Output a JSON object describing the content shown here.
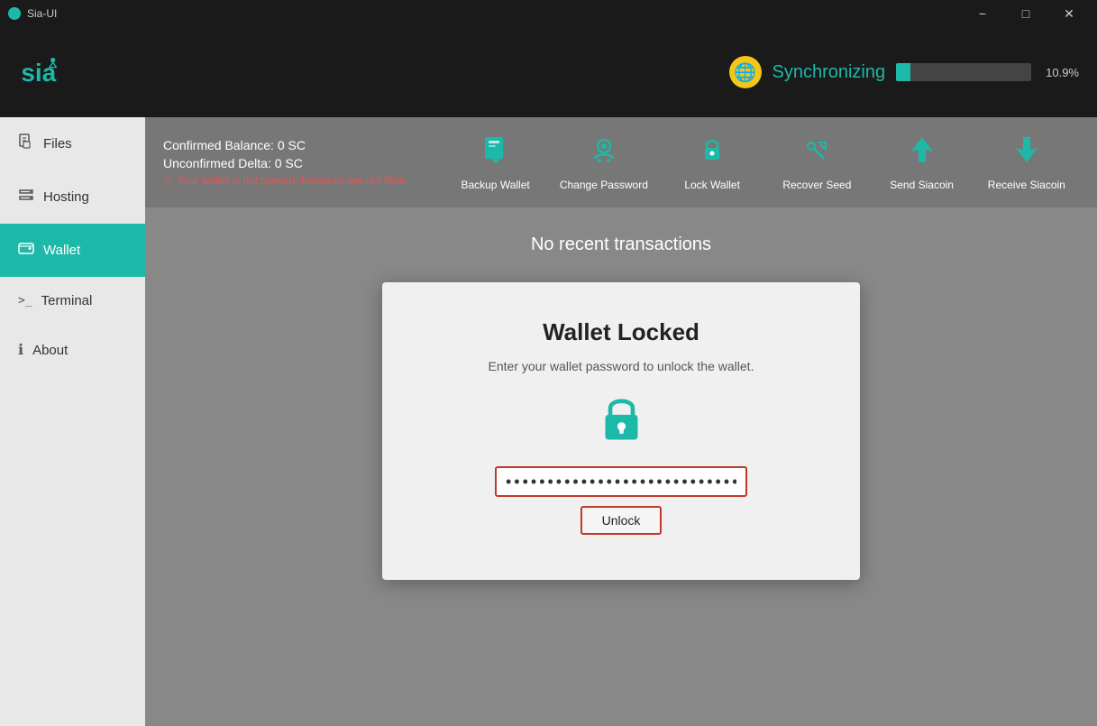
{
  "titlebar": {
    "title": "Sia-UI",
    "minimize_label": "−",
    "maximize_label": "□",
    "close_label": "✕"
  },
  "topbar": {
    "sync_label": "Synchronizing",
    "sync_percent": "10.9%",
    "sync_value": 10.9
  },
  "sidebar": {
    "items": [
      {
        "id": "files",
        "label": "Files",
        "icon": "files"
      },
      {
        "id": "hosting",
        "label": "Hosting",
        "icon": "hosting"
      },
      {
        "id": "wallet",
        "label": "Wallet",
        "icon": "wallet"
      },
      {
        "id": "terminal",
        "label": "Terminal",
        "icon": "terminal"
      },
      {
        "id": "about",
        "label": "About",
        "icon": "about"
      }
    ],
    "active": "wallet"
  },
  "wallet": {
    "confirmed_balance_label": "Confirmed Balance: 0 SC",
    "unconfirmed_delta_label": "Unconfirmed Delta: 0 SC",
    "warning_text": "Your wallet is not synced, balances are not final.",
    "actions": [
      {
        "id": "backup-wallet",
        "label": "Backup Wallet"
      },
      {
        "id": "change-password",
        "label": "Change Password"
      },
      {
        "id": "lock-wallet",
        "label": "Lock Wallet"
      },
      {
        "id": "recover-seed",
        "label": "Recover Seed"
      },
      {
        "id": "send-siacoin",
        "label": "Send Siacoin"
      },
      {
        "id": "receive-siacoin",
        "label": "Receive Siacoin"
      }
    ]
  },
  "transactions": {
    "empty_label": "No recent transactions"
  },
  "locked_modal": {
    "title": "Wallet Locked",
    "subtitle": "Enter your wallet password to unlock the wallet.",
    "password_placeholder": "••••••••••••••••••••••••••••••••••••••••",
    "password_value": "••••••••••••••••••••••••••••••••••••••••",
    "unlock_label": "Unlock"
  }
}
